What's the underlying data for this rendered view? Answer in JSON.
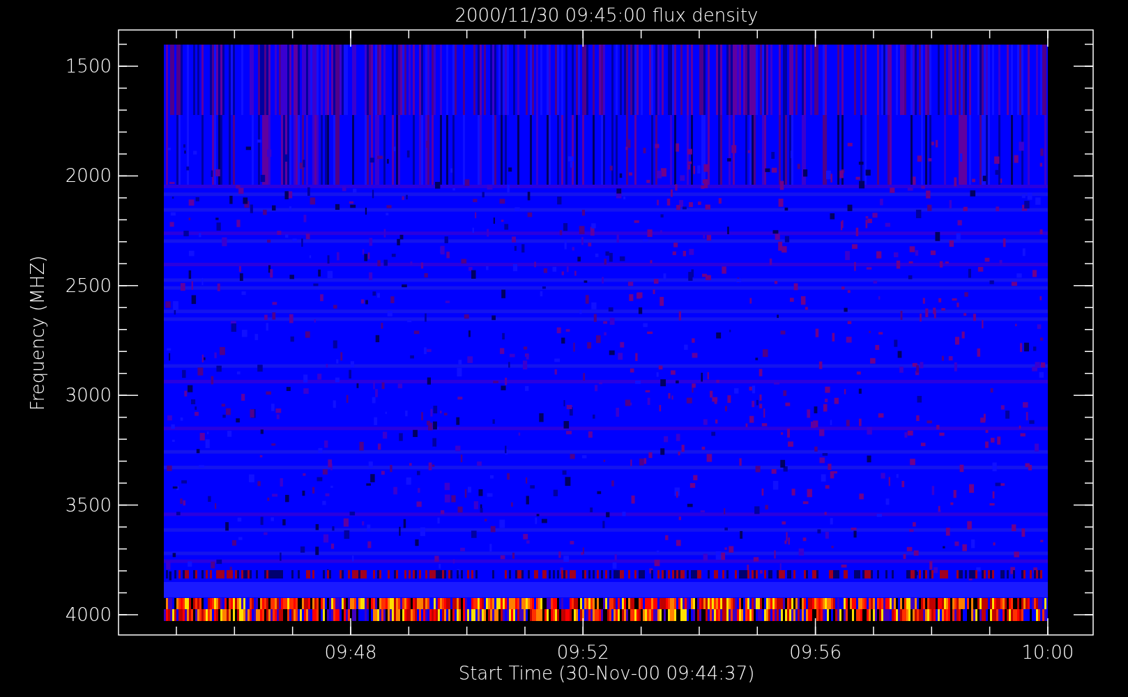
{
  "title": "2000/11/30 09:45:00 flux density",
  "y_axis": {
    "label": "Frequency (MHZ)",
    "ticks": [
      "1500",
      "2000",
      "2500",
      "3000",
      "3500",
      "4000"
    ]
  },
  "x_axis": {
    "label": "Start Time (30-Nov-00 09:44:37)",
    "ticks": [
      "09:48",
      "09:52",
      "09:56",
      "10:00"
    ]
  }
}
